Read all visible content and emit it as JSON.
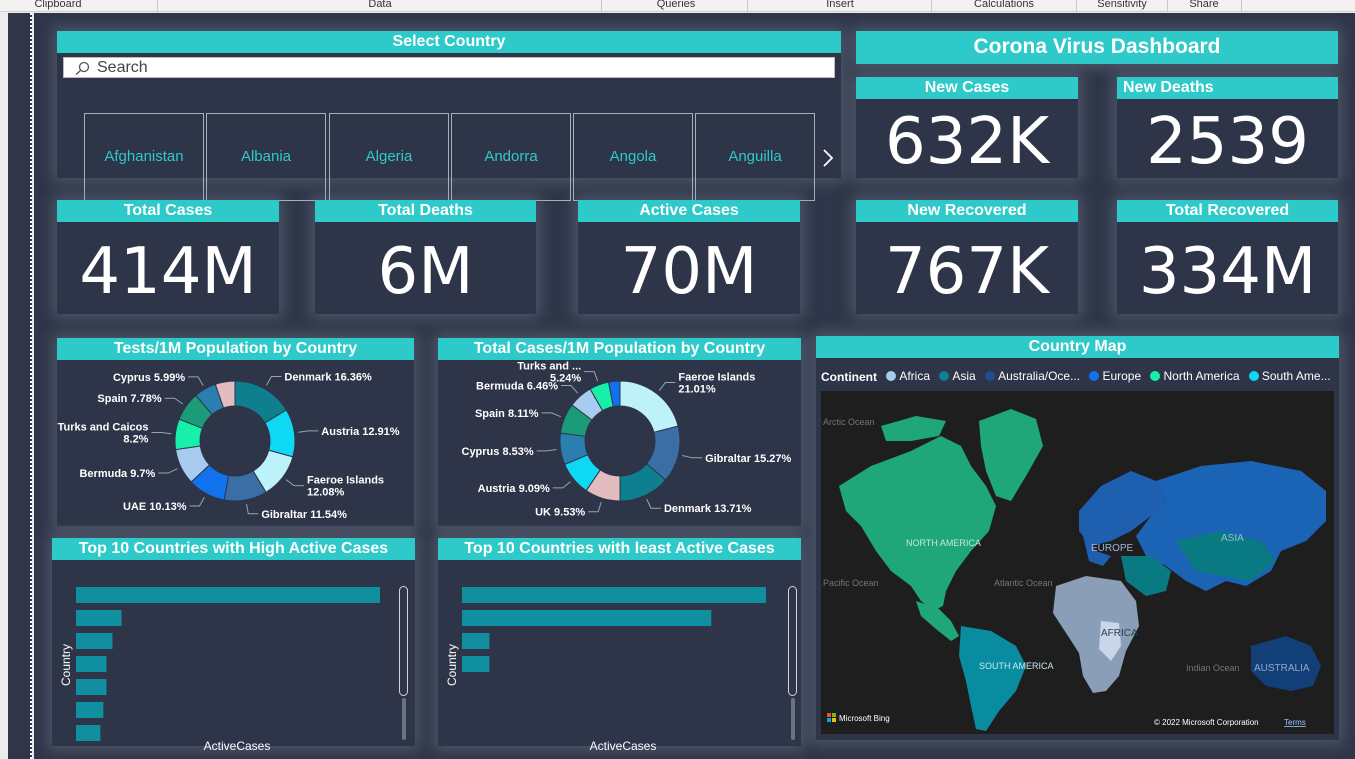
{
  "ribbon": [
    "Clipboard",
    "Data",
    "Queries",
    "Insert",
    "Calculations",
    "Sensitivity",
    "Share"
  ],
  "slicer": {
    "title": "Select Country",
    "search_placeholder": "Search",
    "countries": [
      "Afghanistan",
      "Albania",
      "Algeria",
      "Andorra",
      "Angola",
      "Anguilla"
    ]
  },
  "dashboard_title": "Corona Virus Dashboard",
  "kpis": {
    "new_cases": {
      "label": "New Cases",
      "value": "632K"
    },
    "new_deaths": {
      "label": "New Deaths",
      "value": "2539"
    },
    "total_cases": {
      "label": "Total Cases",
      "value": "414M"
    },
    "total_deaths": {
      "label": "Total Deaths",
      "value": "6M"
    },
    "active_cases": {
      "label": "Active Cases",
      "value": "70M"
    },
    "new_recovered": {
      "label": "New Recovered",
      "value": "767K"
    },
    "total_recovered": {
      "label": "Total Recovered",
      "value": "334M"
    }
  },
  "chart_data": [
    {
      "type": "pie",
      "title": "Tests/1M Population by Country",
      "slices": [
        {
          "label": "Denmark 16.36%",
          "value": 16.36,
          "color": "#0d7f8f"
        },
        {
          "label": "Austria 12.91%",
          "value": 12.91,
          "color": "#0fd8f5"
        },
        {
          "label": "Faeroe Islands 12.08%",
          "value": 12.08,
          "color": "#bdf2fb"
        },
        {
          "label": "Gibraltar 11.54%",
          "value": 11.54,
          "color": "#3a6ea5"
        },
        {
          "label": "UAE 10.13%",
          "value": 10.13,
          "color": "#1172ee"
        },
        {
          "label": "Bermuda 9.7%",
          "value": 9.7,
          "color": "#a8cbf0"
        },
        {
          "label": "Turks and Caicos 8.2%",
          "value": 8.2,
          "color": "#16f0a8"
        },
        {
          "label": "Spain 7.78%",
          "value": 7.78,
          "color": "#1a9c78"
        },
        {
          "label": "Cyprus 5.99%",
          "value": 5.99,
          "color": "#2b7fb0"
        },
        {
          "label": "",
          "value": 5.31,
          "color": "#e3bcc0"
        }
      ]
    },
    {
      "type": "pie",
      "title": "Total Cases/1M Population by Country",
      "slices": [
        {
          "label": "Faeroe Islands 21.01%",
          "value": 21.01,
          "color": "#bdf2fb"
        },
        {
          "label": "Gibraltar 15.27%",
          "value": 15.27,
          "color": "#3a6ea5"
        },
        {
          "label": "Denmark 13.71%",
          "value": 13.71,
          "color": "#0d7f8f"
        },
        {
          "label": "UK 9.53%",
          "value": 9.53,
          "color": "#e3bcc0"
        },
        {
          "label": "Austria 9.09%",
          "value": 9.09,
          "color": "#0fd8f5"
        },
        {
          "label": "Cyprus 8.53%",
          "value": 8.53,
          "color": "#2b7fb0"
        },
        {
          "label": "Spain 8.11%",
          "value": 8.11,
          "color": "#1a9c78"
        },
        {
          "label": "Bermuda 6.46%",
          "value": 6.46,
          "color": "#a8cbf0"
        },
        {
          "label": "Turks and ... 5.24%",
          "value": 5.24,
          "color": "#16f0a8"
        },
        {
          "label": "",
          "value": 3.05,
          "color": "#1172ee"
        }
      ]
    },
    {
      "type": "bar",
      "title": "Top 10 Countries with High Active Cases",
      "xlabel": "ActiveCases",
      "ylabel": "Country",
      "values": [
        100,
        15,
        12,
        10,
        10,
        9,
        8
      ],
      "color": "#0f8fa0"
    },
    {
      "type": "bar",
      "title": "Top 10 Countries with least Active Cases",
      "xlabel": "ActiveCases",
      "ylabel": "Country",
      "values": [
        100,
        82,
        9,
        9
      ],
      "color": "#0f8fa0"
    }
  ],
  "map": {
    "title": "Country Map",
    "legend_title": "Continent",
    "legend": [
      {
        "label": "Africa",
        "color": "#a8cbf0"
      },
      {
        "label": "Asia",
        "color": "#0d7f8f"
      },
      {
        "label": "Australia/Oce...",
        "color": "#1f4f8f"
      },
      {
        "label": "Europe",
        "color": "#1172ee"
      },
      {
        "label": "North America",
        "color": "#16f0a8"
      },
      {
        "label": "South Ame...",
        "color": "#0fd8f5"
      }
    ],
    "map_labels": {
      "arctic": "Arctic Ocean",
      "north_america": "NORTH AMERICA",
      "atlantic": "Atlantic Ocean",
      "pacific": "Pacific Ocean",
      "europe": "EUROPE",
      "asia": "ASIA",
      "africa": "AFRICA",
      "south_america": "SOUTH AMERICA",
      "indian": "Indian Ocean",
      "australia": "AUSTRALIA"
    },
    "attribution": "Microsoft Bing",
    "copyright": "© 2022 Microsoft Corporation",
    "terms": "Terms"
  }
}
